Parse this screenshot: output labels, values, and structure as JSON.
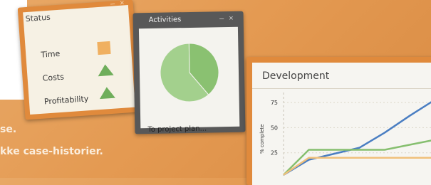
{
  "status_panel": {
    "title": "Status",
    "controls": "– ×",
    "rows": [
      {
        "label": "Time",
        "indicator": "square",
        "color": "#f0b060"
      },
      {
        "label": "Costs",
        "indicator": "triangle-up",
        "color": "#6fae5b"
      },
      {
        "label": "Profitability",
        "indicator": "triangle-up",
        "color": "#6fae5b"
      }
    ]
  },
  "activities_panel": {
    "title": "Activities",
    "controls": "– ×",
    "caption": "To project plan...",
    "pie": {
      "slices": [
        {
          "share": 0.39,
          "color": "#8ac171"
        },
        {
          "share": 0.61,
          "color": "#a3d08d"
        }
      ]
    }
  },
  "development_panel": {
    "title": "Development",
    "chart_data": {
      "type": "line",
      "ylabel": "% complete",
      "yticks": [
        "75",
        "50",
        "25"
      ],
      "ylim": [
        0,
        85
      ],
      "x": [
        0,
        1,
        2,
        3,
        4,
        5,
        6
      ],
      "series": [
        {
          "color": "#4a7ec2",
          "values": [
            3,
            18,
            24,
            30,
            45,
            62,
            78
          ]
        },
        {
          "color": "#86bf6f",
          "values": [
            3,
            28,
            28,
            28,
            28,
            33,
            38
          ]
        },
        {
          "color": "#f0c07a",
          "values": [
            3,
            20,
            20,
            20,
            20,
            20,
            20
          ]
        }
      ]
    }
  },
  "footer": {
    "line1": "se.",
    "line2": "kke case-historier."
  }
}
